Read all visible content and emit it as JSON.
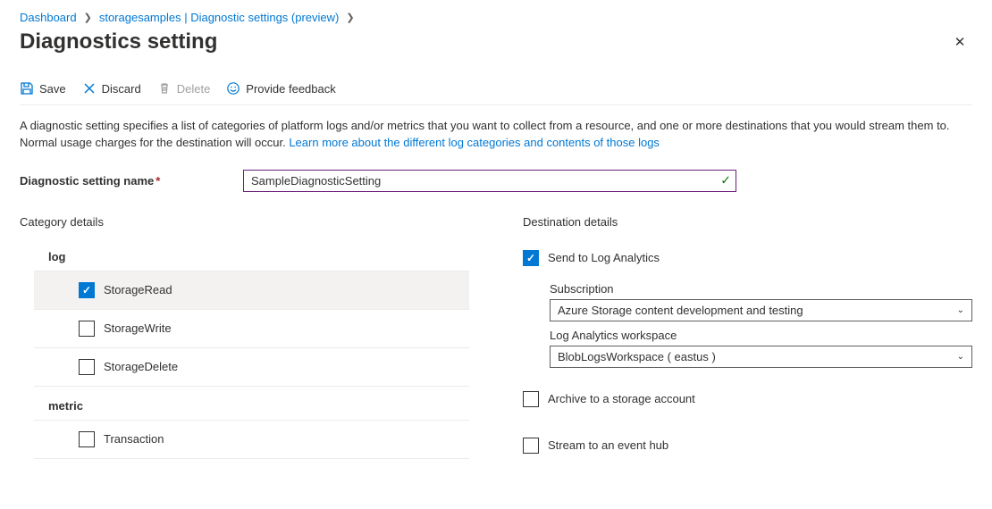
{
  "breadcrumb": {
    "items": [
      {
        "label": "Dashboard"
      },
      {
        "label": "storagesamples | Diagnostic settings (preview)"
      }
    ]
  },
  "page": {
    "title": "Diagnostics setting"
  },
  "toolbar": {
    "save": "Save",
    "discard": "Discard",
    "delete": "Delete",
    "feedback": "Provide feedback"
  },
  "description": {
    "text": "A diagnostic setting specifies a list of categories of platform logs and/or metrics that you want to collect from a resource, and one or more destinations that you would stream them to. Normal usage charges for the destination will occur. ",
    "link": "Learn more about the different log categories and contents of those logs"
  },
  "form": {
    "name_label": "Diagnostic setting name",
    "name_value": "SampleDiagnosticSetting"
  },
  "category": {
    "heading": "Category details",
    "log_title": "log",
    "log_items": [
      {
        "label": "StorageRead",
        "checked": true
      },
      {
        "label": "StorageWrite",
        "checked": false
      },
      {
        "label": "StorageDelete",
        "checked": false
      }
    ],
    "metric_title": "metric",
    "metric_items": [
      {
        "label": "Transaction",
        "checked": false
      }
    ]
  },
  "destination": {
    "heading": "Destination details",
    "log_analytics": {
      "label": "Send to Log Analytics",
      "checked": true,
      "subscription_label": "Subscription",
      "subscription_value": "Azure Storage content development and testing",
      "workspace_label": "Log Analytics workspace",
      "workspace_value": "BlobLogsWorkspace ( eastus )"
    },
    "archive": {
      "label": "Archive to a storage account",
      "checked": false
    },
    "eventhub": {
      "label": "Stream to an event hub",
      "checked": false
    }
  }
}
